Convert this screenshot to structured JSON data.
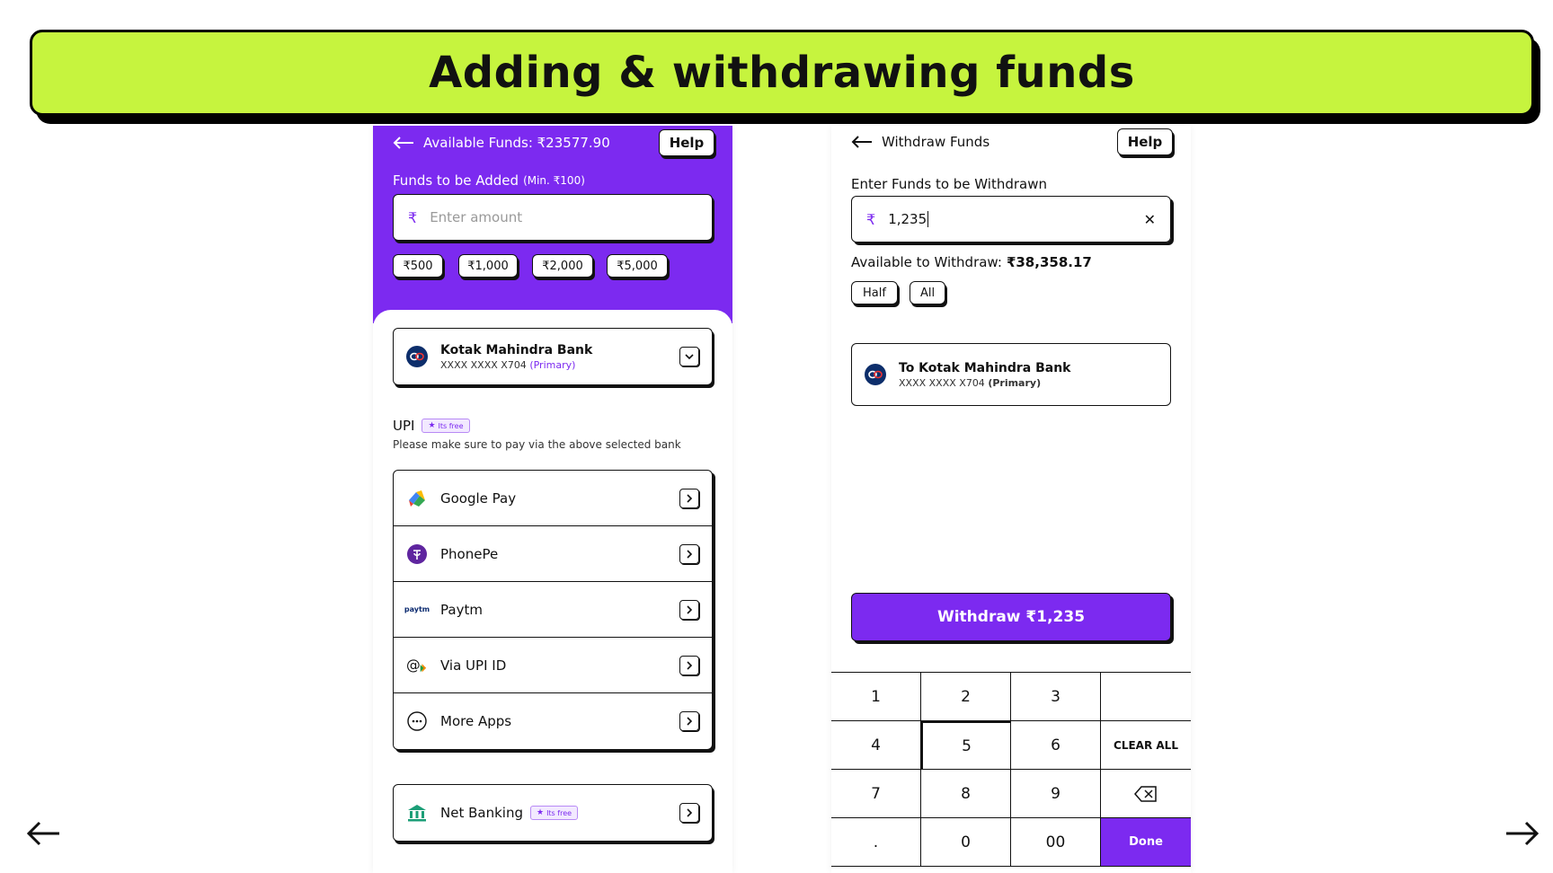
{
  "slide_title": "Adding & withdrawing funds",
  "colors": {
    "accent": "#7c2af0",
    "banner": "#c6f43e"
  },
  "add_funds": {
    "available_label": "Available Funds: ₹23577.90",
    "help": "Help",
    "funds_label": "Funds to be Added",
    "funds_min": "(Min. ₹100)",
    "amount_placeholder": "Enter amount",
    "currency_symbol": "₹",
    "quick_amounts": [
      "₹500",
      "₹1,000",
      "₹2,000",
      "₹5,000"
    ],
    "bank": {
      "name": "Kotak Mahindra Bank",
      "account": "XXXX XXXX X704",
      "tag": "(Primary)"
    },
    "upi_title": "UPI",
    "free_badge": "Its free",
    "upi_note": "Please make sure to pay via the above selected bank",
    "upi_options": [
      {
        "label": "Google Pay",
        "icon": "google-pay-icon"
      },
      {
        "label": "PhonePe",
        "icon": "phonepe-icon"
      },
      {
        "label": "Paytm",
        "icon": "paytm-icon"
      },
      {
        "label": "Via UPI ID",
        "icon": "upi-id-icon"
      },
      {
        "label": "More Apps",
        "icon": "more-apps-icon"
      }
    ],
    "net_banking": "Net Banking",
    "paytm_logo_text": "paytm"
  },
  "withdraw": {
    "title": "Withdraw Funds",
    "help": "Help",
    "enter_label": "Enter Funds to be Withdrawn",
    "currency_symbol": "₹",
    "amount_value": "1,235",
    "available_label": "Available to Withdraw:",
    "available_value": "₹38,358.17",
    "half": "Half",
    "all": "All",
    "bank": {
      "name": "To Kotak Mahindra Bank",
      "account": "XXXX XXXX X704",
      "tag": "(Primary)"
    },
    "withdraw_button": "Withdraw ₹1,235",
    "keypad": [
      "1",
      "2",
      "3",
      "",
      "4",
      "5",
      "6",
      "CLEAR ALL",
      "7",
      "8",
      "9",
      "",
      ".",
      "0",
      "00",
      "Done"
    ]
  }
}
